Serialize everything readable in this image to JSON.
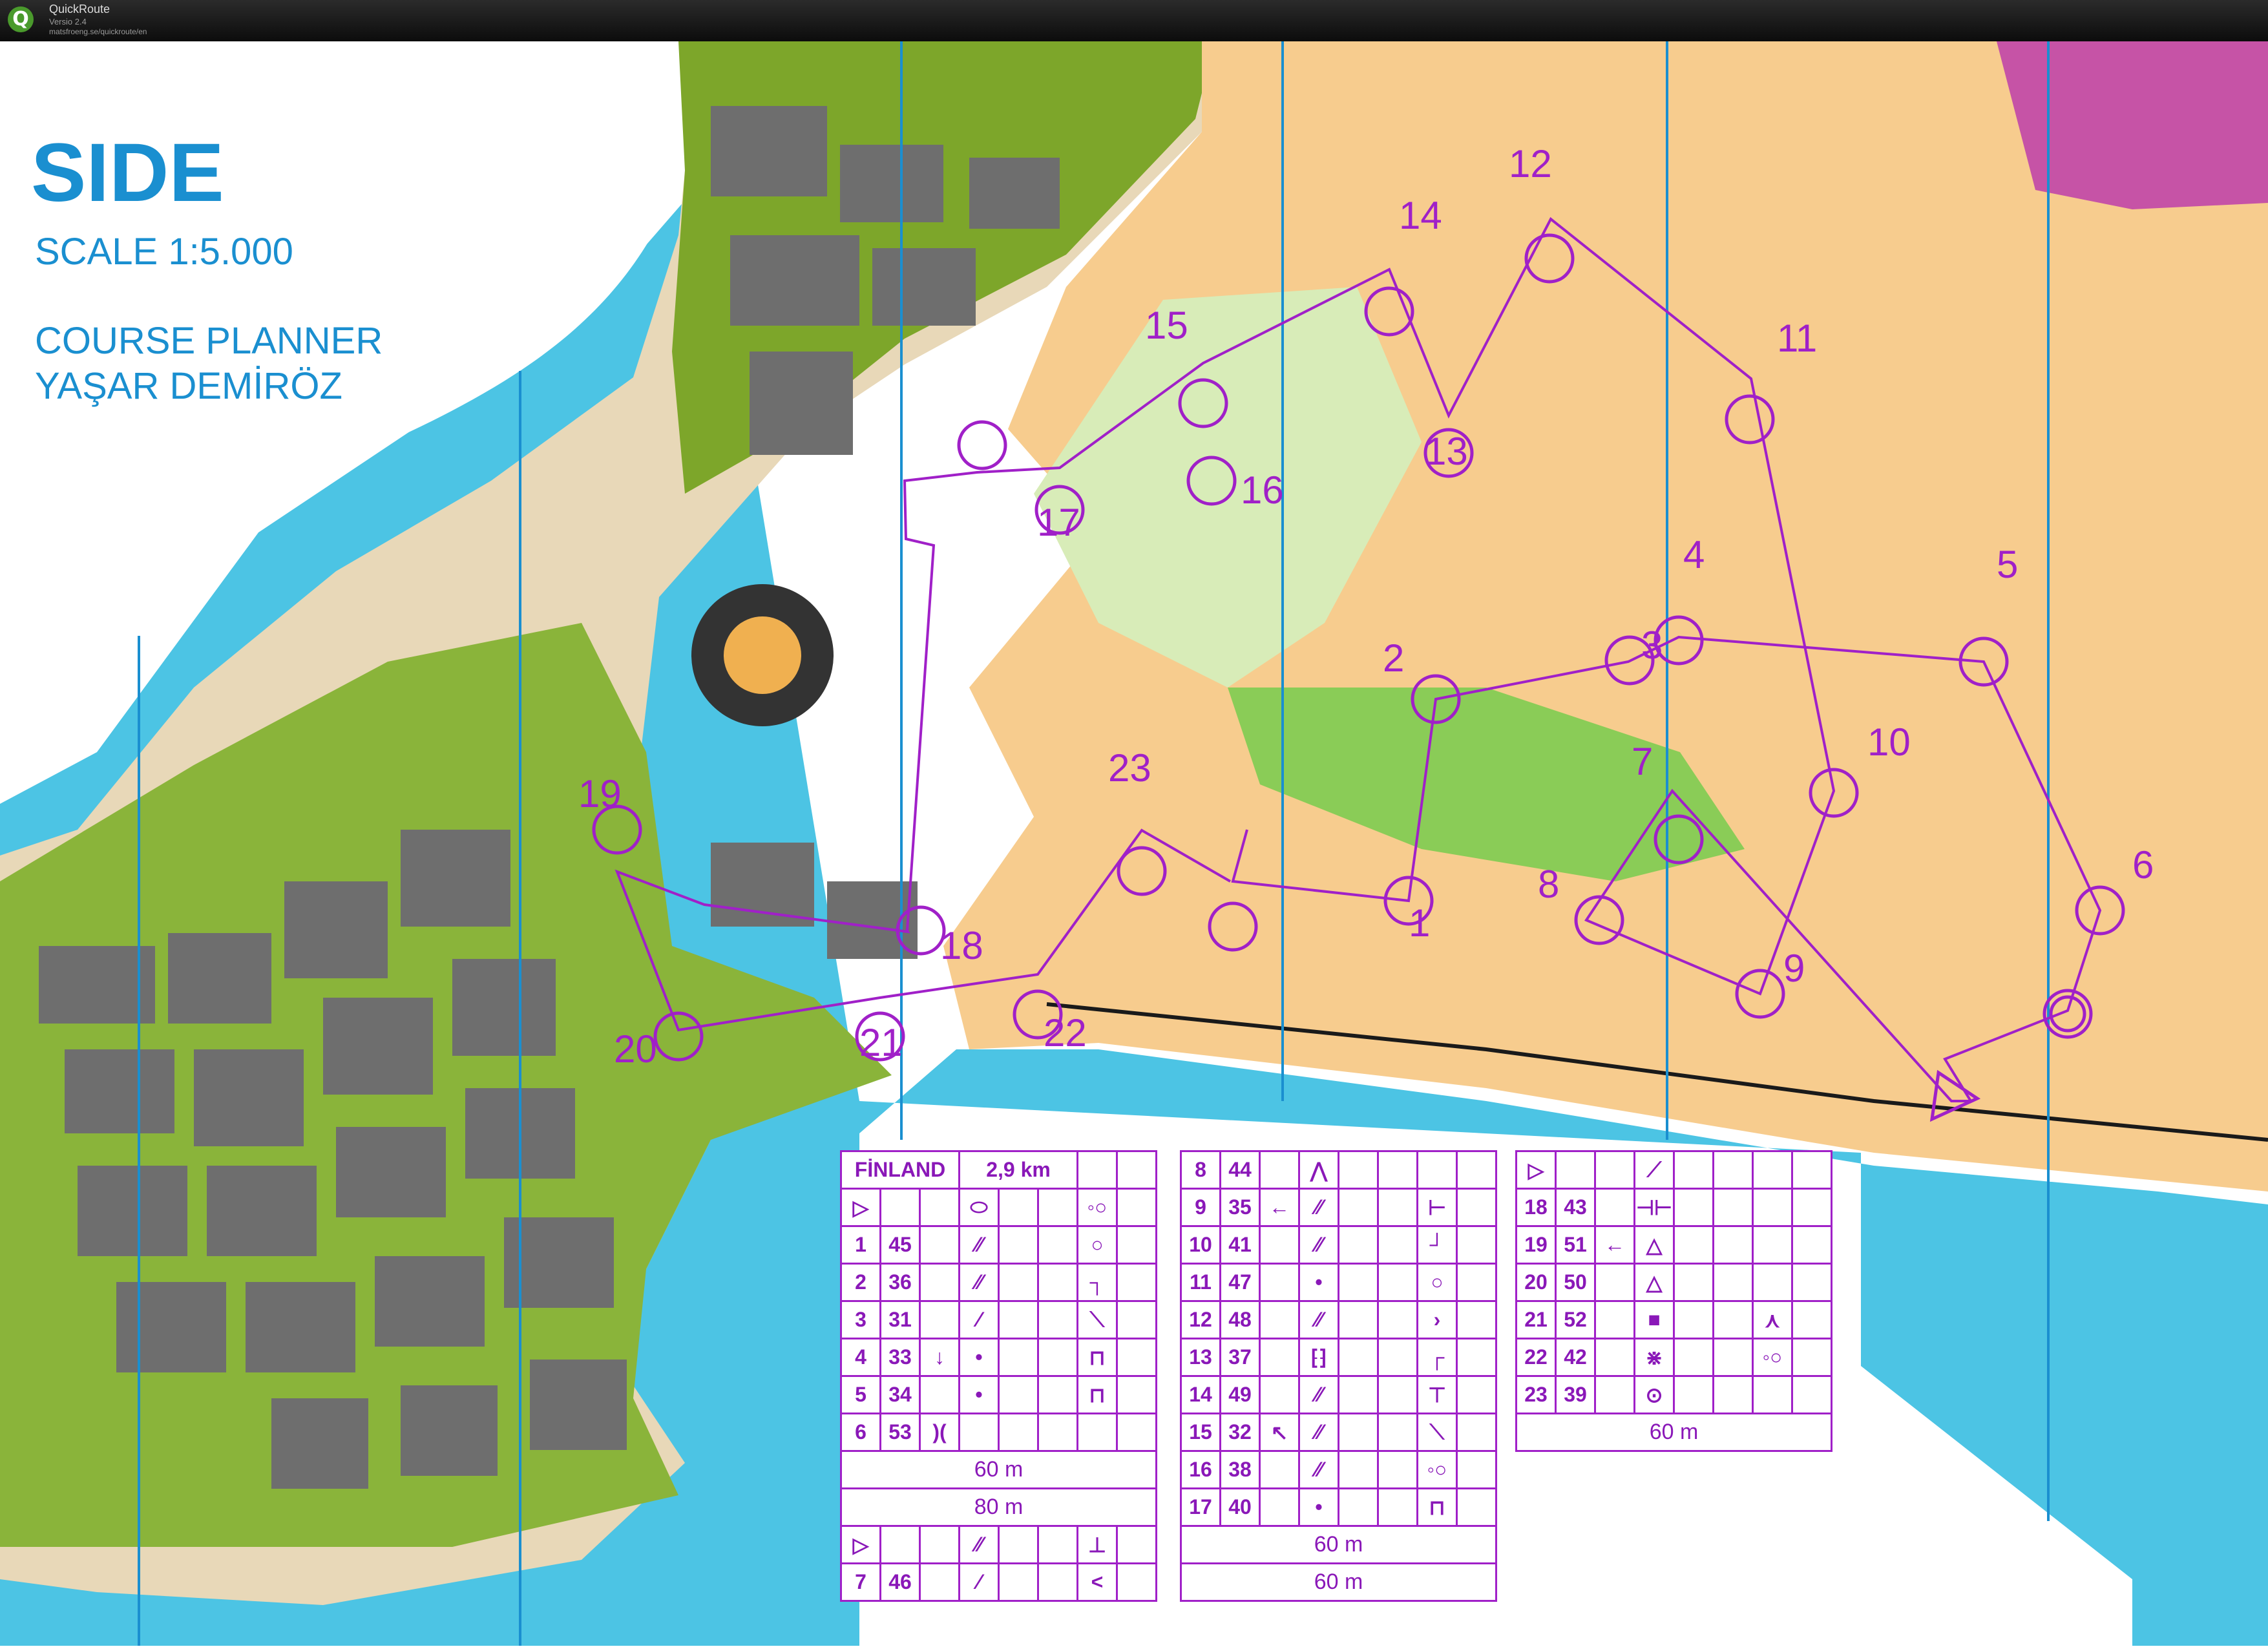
{
  "window": {
    "app_name": "QuickRoute",
    "version": "Versio 2.4",
    "url": "matsfroeng.se/quickroute/en"
  },
  "map": {
    "title": "SIDE",
    "scale": "SCALE 1:5.000",
    "planner_line1": "COURSE PLANNER",
    "planner_line2": "YAŞAR DEMİRÖZ",
    "colors": {
      "sea": "#4cc4e4",
      "course": "#a020c8",
      "forest": "#7da62a",
      "building": "#6e6e6e",
      "open": "#f7cc8e"
    },
    "controls": [
      {
        "n": "1",
        "label": "1"
      },
      {
        "n": "2",
        "label": "2"
      },
      {
        "n": "3",
        "label": "3"
      },
      {
        "n": "4",
        "label": "4"
      },
      {
        "n": "5",
        "label": "5"
      },
      {
        "n": "6",
        "label": "6"
      },
      {
        "n": "7",
        "label": "7"
      },
      {
        "n": "8",
        "label": "8"
      },
      {
        "n": "9",
        "label": "9"
      },
      {
        "n": "10",
        "label": "10"
      },
      {
        "n": "11",
        "label": "11"
      },
      {
        "n": "12",
        "label": "12"
      },
      {
        "n": "13",
        "label": "13"
      },
      {
        "n": "14",
        "label": "14"
      },
      {
        "n": "15",
        "label": "15"
      },
      {
        "n": "16",
        "label": "16"
      },
      {
        "n": "17",
        "label": "17"
      },
      {
        "n": "18",
        "label": "18"
      },
      {
        "n": "19",
        "label": "19"
      },
      {
        "n": "20",
        "label": "20"
      },
      {
        "n": "21",
        "label": "21"
      },
      {
        "n": "22",
        "label": "22"
      },
      {
        "n": "23",
        "label": "23"
      }
    ]
  },
  "legend": {
    "course": "FİNLAND",
    "length": "2,9 km",
    "col1": [
      {
        "n": "1",
        "code": "45"
      },
      {
        "n": "2",
        "code": "36"
      },
      {
        "n": "3",
        "code": "31"
      },
      {
        "n": "4",
        "code": "33"
      },
      {
        "n": "5",
        "code": "34"
      },
      {
        "n": "6",
        "code": "53"
      }
    ],
    "col1_route_a": "60 m",
    "col1_route_b": "80 m",
    "col1_last": {
      "n": "7",
      "code": "46"
    },
    "col2": [
      {
        "n": "8",
        "code": "44"
      },
      {
        "n": "9",
        "code": "35"
      },
      {
        "n": "10",
        "code": "41"
      },
      {
        "n": "11",
        "code": "47"
      },
      {
        "n": "12",
        "code": "48"
      },
      {
        "n": "13",
        "code": "37"
      },
      {
        "n": "14",
        "code": "49"
      },
      {
        "n": "15",
        "code": "32"
      },
      {
        "n": "16",
        "code": "38"
      },
      {
        "n": "17",
        "code": "40"
      }
    ],
    "col2_route_a": "60 m",
    "col2_route_b": "60 m",
    "col3": [
      {
        "n": "18",
        "code": "43"
      },
      {
        "n": "19",
        "code": "51"
      },
      {
        "n": "20",
        "code": "50"
      },
      {
        "n": "21",
        "code": "52"
      },
      {
        "n": "22",
        "code": "42"
      },
      {
        "n": "23",
        "code": "39"
      }
    ],
    "col3_route": "60 m"
  }
}
